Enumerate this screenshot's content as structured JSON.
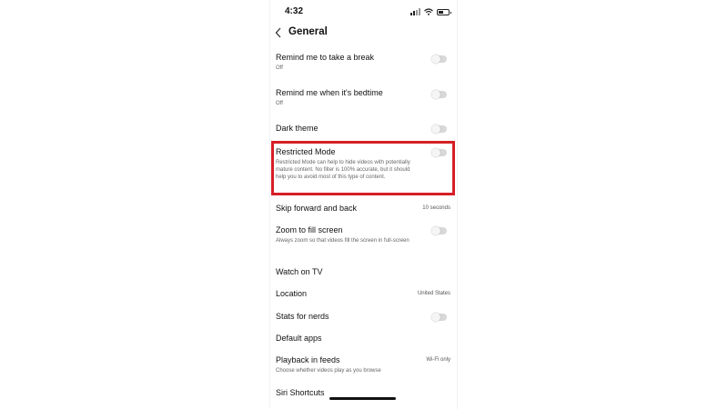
{
  "status_bar": {
    "time": "4:32"
  },
  "header": {
    "title": "General"
  },
  "settings": [
    {
      "title": "Remind me to take a break",
      "subtitle": "Off",
      "toggle": false
    },
    {
      "title": "Remind me when it's bedtime",
      "subtitle": "Off",
      "toggle": false
    },
    {
      "title": "Dark theme",
      "toggle": false
    },
    {
      "title": "Restricted Mode",
      "subtitle": "Restricted Mode can help to hide videos with potentially mature content. No filter is 100% accurate, but it should help you to avoid most of this type of content.",
      "toggle": false
    },
    {
      "title": "Skip forward and back",
      "value": "10 seconds"
    },
    {
      "title": "Zoom to fill screen",
      "subtitle": "Always zoom so that videos fill the screen in full-screen",
      "toggle": false
    },
    {
      "title": "Watch on TV"
    },
    {
      "title": "Location",
      "value": "United States"
    },
    {
      "title": "Stats for nerds",
      "toggle": false
    },
    {
      "title": "Default apps"
    },
    {
      "title": "Playback in feeds",
      "subtitle": "Choose whether videos play as you browse",
      "value": "Wi-Fi only"
    },
    {
      "title": "Siri Shortcuts"
    }
  ],
  "colors": {
    "highlight": "#d61f26",
    "toggle_track": "#d8d8d8"
  }
}
